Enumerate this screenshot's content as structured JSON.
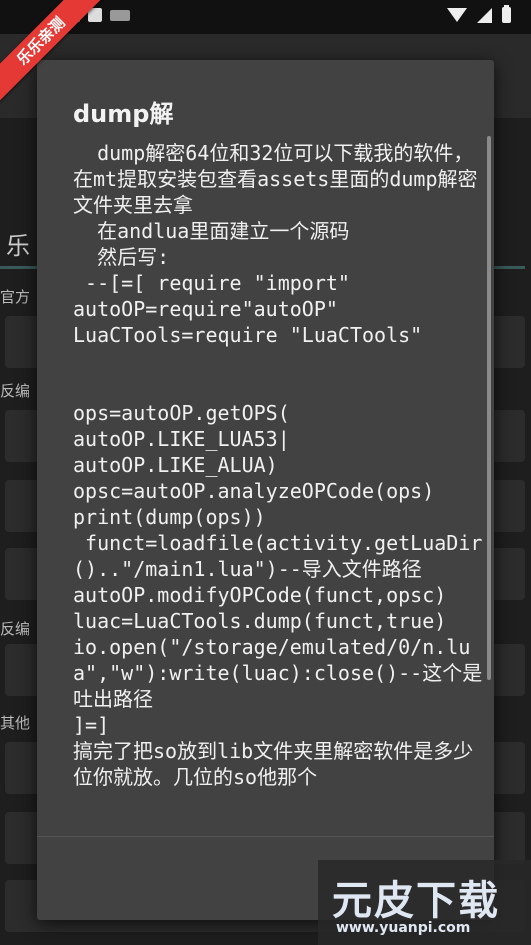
{
  "ribbon": "乐乐亲测",
  "background": {
    "tab": "乐",
    "labels": [
      "官方",
      "反编",
      "反编",
      "其他"
    ]
  },
  "dialog": {
    "title": "dump解",
    "body": "  dump解密64位和32位可以下载我的软件，在mt提取安装包查看assets里面的dump解密文件夹里去拿\n  在andlua里面建立一个源码\n  然后写:\n --[=[ require \"import\"\nautoOP=require\"autoOP\"\nLuaCTools=require \"LuaCTools\"\n\n\nops=autoOP.getOPS(\nautoOP.LIKE_LUA53|\nautoOP.LIKE_ALUA)\nopsc=autoOP.analyzeOPCode(ops)\nprint(dump(ops))\n funct=loadfile(activity.getLuaDir()..\"/main1.lua\")--导入文件路径\nautoOP.modifyOPCode(funct,opsc)\nluac=LuaCTools.dump(funct,true)\nio.open(\"/storage/emulated/0/n.lua\",\"w\"):write(luac):close()--这个是吐出路径\n]=]\n搞完了把so放到lib文件夹里解密软件是多少位你就放。几位的so他那个"
  },
  "watermark": {
    "logo": "元皮下载",
    "url": "www.yuanpi.com"
  }
}
